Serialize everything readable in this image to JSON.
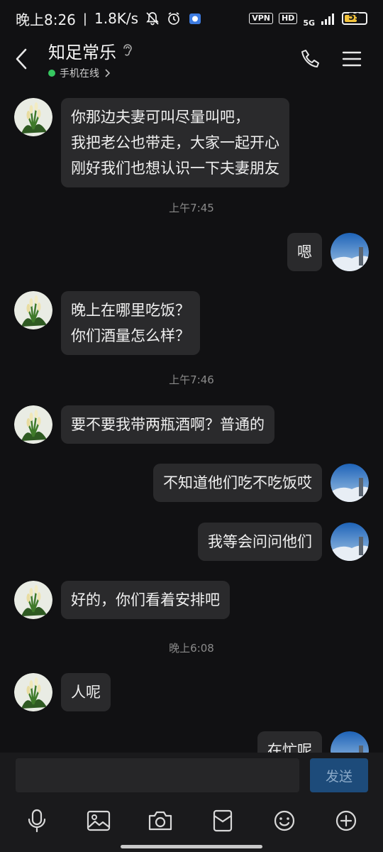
{
  "status": {
    "time": "晚上8:26",
    "speed": "1.8K/s",
    "vpn": "VPN",
    "hd": "HD",
    "net": "5G",
    "battery": "59",
    "battery_level": 0.59
  },
  "header": {
    "contact_name": "知足常乐",
    "presence": "手机在线"
  },
  "messages": [
    {
      "side": "incoming",
      "text": "你那边夫妻可叫尽量叫吧，\n我把老公也带走，大家一起开心\n刚好我们也想认识一下夫妻朋友"
    },
    {
      "timestamp": "上午7:45"
    },
    {
      "side": "outgoing",
      "text": "嗯"
    },
    {
      "side": "incoming",
      "text": "晚上在哪里吃饭？\n你们酒量怎么样？"
    },
    {
      "timestamp": "上午7:46"
    },
    {
      "side": "incoming",
      "text": "要不要我带两瓶酒啊？普通的"
    },
    {
      "side": "outgoing",
      "text": "不知道他们吃不吃饭哎"
    },
    {
      "side": "outgoing",
      "text": "我等会问问他们"
    },
    {
      "side": "incoming",
      "text": "好的，你们看着安排吧"
    },
    {
      "timestamp": "晚上6:08"
    },
    {
      "side": "incoming",
      "text": "人呢"
    },
    {
      "side": "outgoing",
      "text": "在忙呢"
    }
  ],
  "input": {
    "value": "",
    "placeholder": "",
    "send_label": "发送"
  },
  "toolbar": [
    "mic-icon",
    "image-icon",
    "camera-icon",
    "red-packet-icon",
    "emoji-icon",
    "plus-icon"
  ]
}
